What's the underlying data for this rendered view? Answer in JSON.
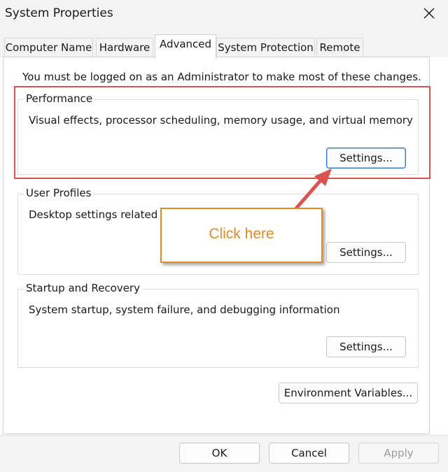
{
  "window": {
    "title": "System Properties",
    "close_icon": "close-icon"
  },
  "tabs": [
    {
      "label": "Computer Name",
      "active": false
    },
    {
      "label": "Hardware",
      "active": false
    },
    {
      "label": "Advanced",
      "active": true
    },
    {
      "label": "System Protection",
      "active": false
    },
    {
      "label": "Remote",
      "active": false
    }
  ],
  "admin_note": "You must be logged on as an Administrator to make most of these changes.",
  "performance": {
    "label": "Performance",
    "description": "Visual effects, processor scheduling, memory usage, and virtual memory",
    "settings_button": "Settings..."
  },
  "user_profiles": {
    "label": "User Profiles",
    "description": "Desktop settings related to",
    "settings_button": "Settings..."
  },
  "startup_recovery": {
    "label": "Startup and Recovery",
    "description": "System startup, system failure, and debugging information",
    "settings_button": "Settings..."
  },
  "environment_variables_button": "Environment Variables...",
  "footer": {
    "ok": "OK",
    "cancel": "Cancel",
    "apply": "Apply"
  },
  "annotation": {
    "callout_text": "Click here",
    "callout_color": "#e08b23",
    "highlight_color": "#d9534f",
    "arrow_color": "#d9534f"
  }
}
